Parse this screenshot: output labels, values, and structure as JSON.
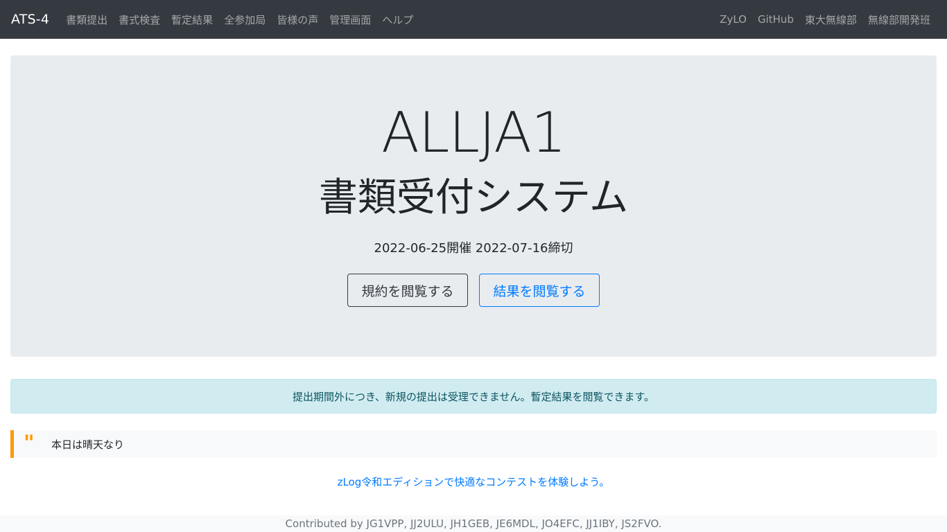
{
  "navbar": {
    "brand": "ATS-4",
    "left_links": [
      "書類提出",
      "書式検査",
      "暫定結果",
      "全参加局",
      "皆様の声",
      "管理画面",
      "ヘルプ"
    ],
    "right_links": [
      "ZyLO",
      "GitHub",
      "東大無線部",
      "無線部開発班"
    ]
  },
  "hero": {
    "title": "ALLJA1",
    "subtitle": "書類受付システム",
    "dates": "2022-06-25開催 2022-07-16締切",
    "rules_button": "規約を閲覧する",
    "results_button": "結果を閲覧する"
  },
  "alert": {
    "text": "提出期間外につき、新規の提出は受理できません。暫定結果を閲覧できます。"
  },
  "quote": {
    "icon": "quote-icon",
    "text": "本日は晴天なり"
  },
  "promo": {
    "text": "zLog令和エディションで快適なコンテストを体験しよう。"
  },
  "footer": {
    "text": "Contributed by JG1VPP, JJ2ULU, JH1GEB, JE6MDL, JO4EFC, JJ1IBY, JS2FVO."
  },
  "colors": {
    "navbar": "#343a40",
    "jumbotron": "#e9ecef",
    "alert_bg": "#d1ecf1",
    "alert_text": "#0c5460",
    "quote_accent": "#fd9a00",
    "link": "#007bff"
  }
}
